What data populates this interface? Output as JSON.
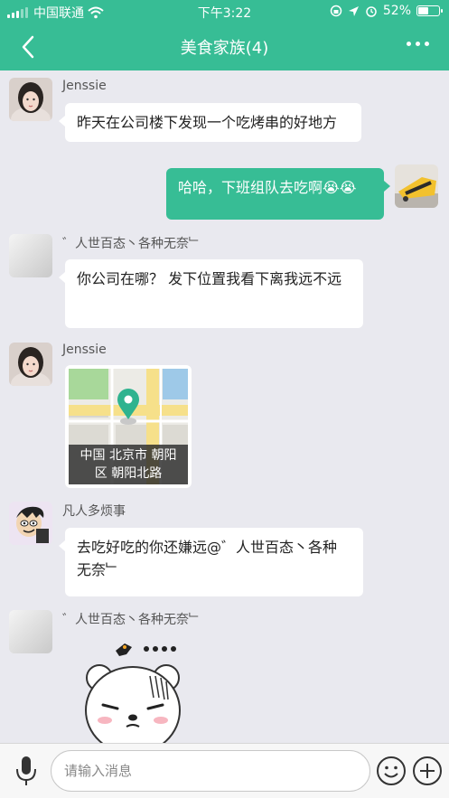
{
  "status_bar": {
    "carrier": "中国联通",
    "time": "下午3:22",
    "battery": "52%",
    "battery_level": 0.52
  },
  "chat": {
    "title": "美食家族(4)"
  },
  "messages": [
    {
      "sender": "Jenssie",
      "text": "昨天在公司楼下发现一个吃烤串的好地方"
    },
    {
      "sender": "me",
      "text": "哈哈，下班组队去吃啊😭😭"
    },
    {
      "sender": "゛人世百态丶各种无奈﹂",
      "text": "你公司在哪？ 发下位置我看下离我远不远"
    },
    {
      "sender": "Jenssie",
      "location_line1": "中国 北京市 朝阳",
      "location_line2": "区 朝阳北路"
    },
    {
      "sender": "凡人多烦事",
      "text_line1": "去吃好吃的你还嫌远@゛人世百态丶各种",
      "text_line2": "无奈﹂"
    },
    {
      "sender": "゛人世百态丶各种无奈﹂",
      "sticker": "bear-sticker"
    }
  ],
  "input": {
    "placeholder": "请输入消息"
  },
  "colors": {
    "accent": "#37bd95",
    "background": "#e9e9ef"
  }
}
